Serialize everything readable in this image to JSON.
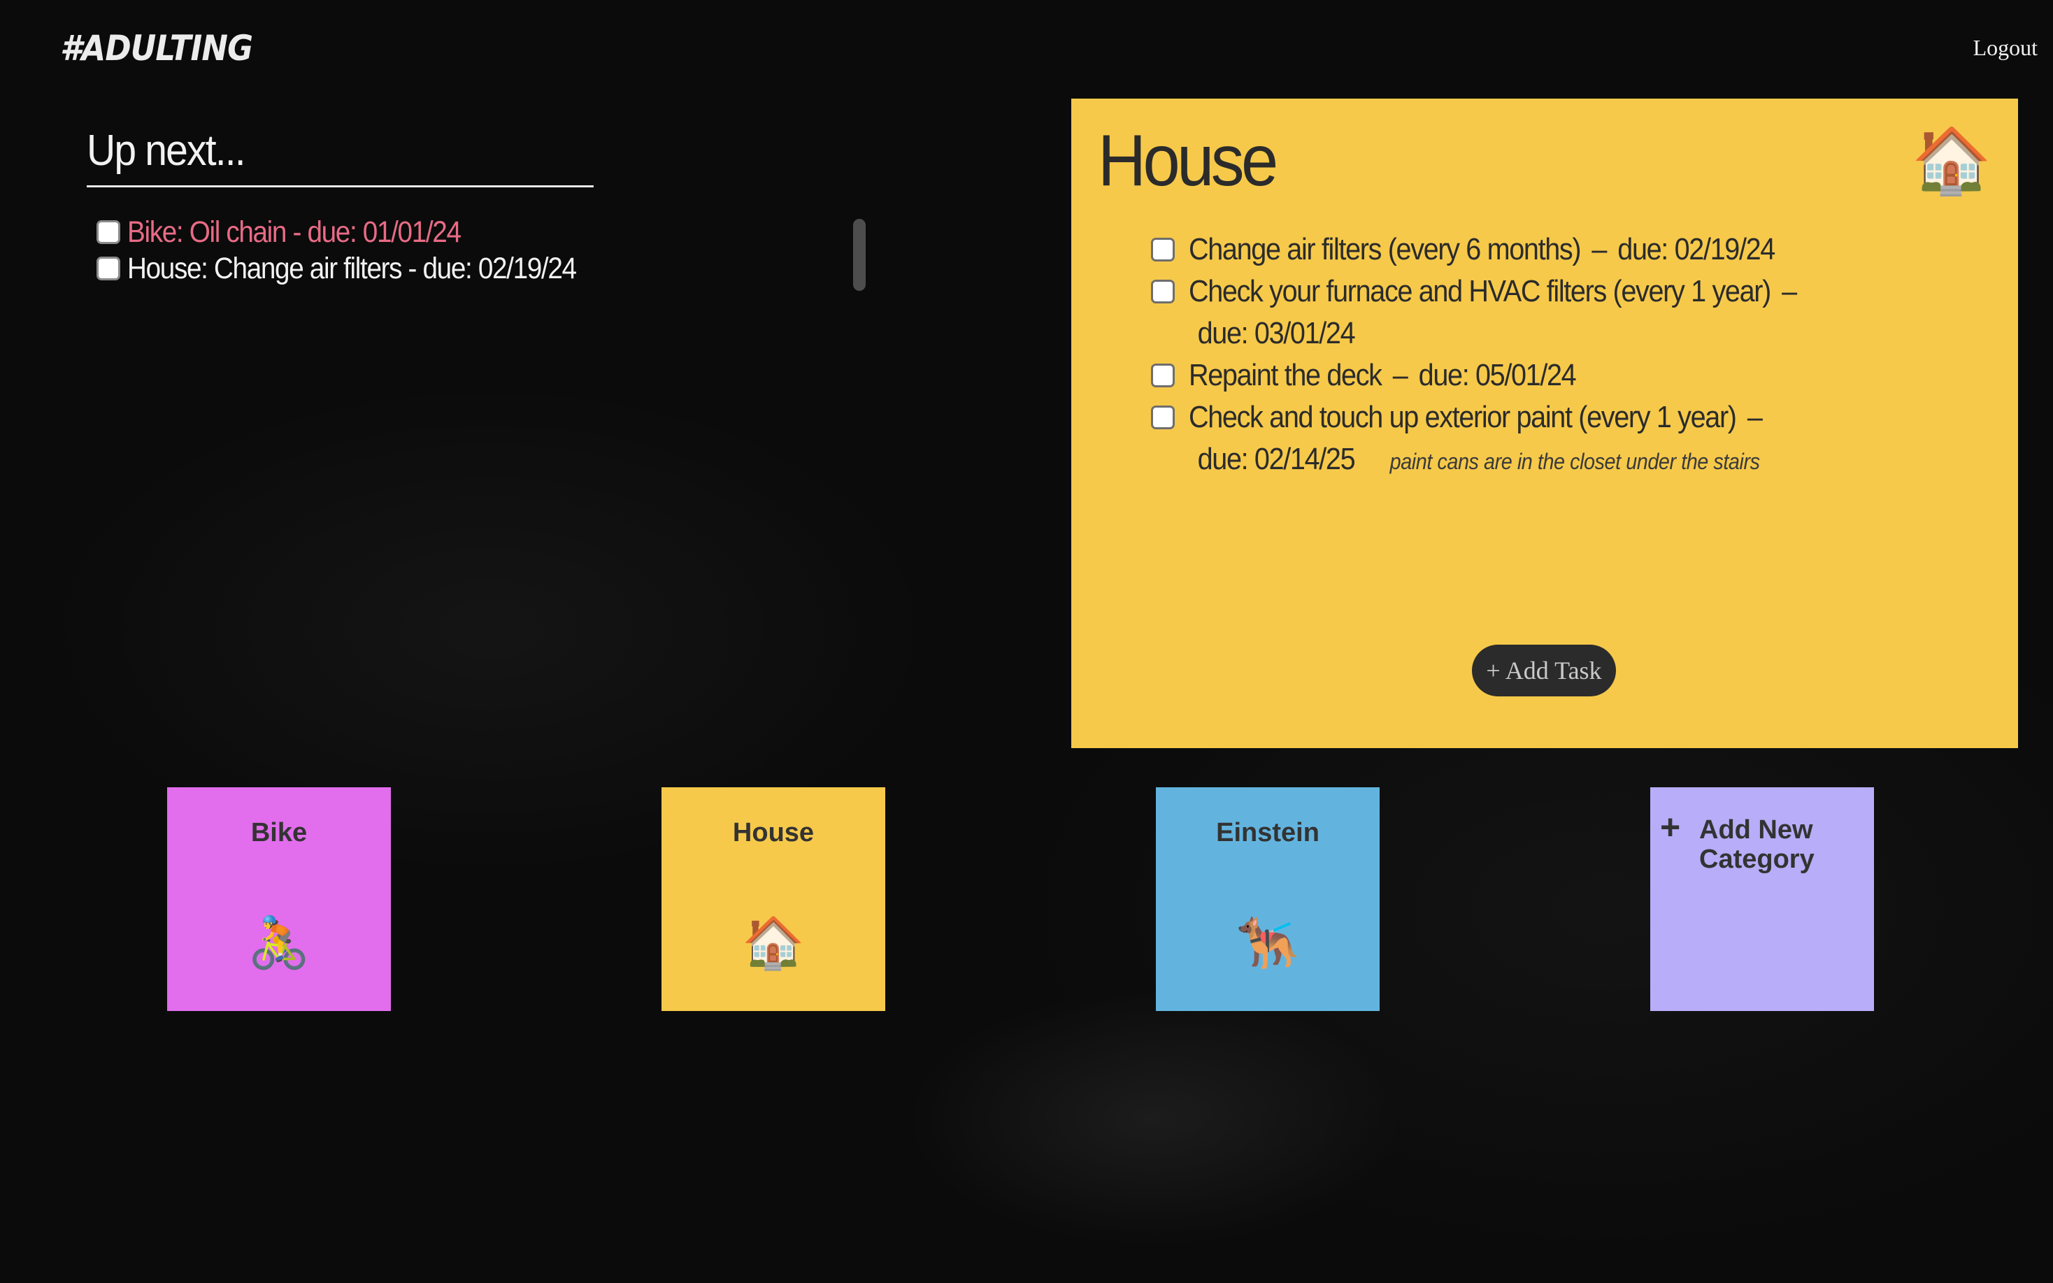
{
  "header": {
    "logo": "#ADULTING",
    "logout_label": "Logout"
  },
  "up_next": {
    "title": "Up next...",
    "items": [
      {
        "label": "Bike: Oil chain - due: 01/01/24",
        "status": "overdue",
        "checked": false
      },
      {
        "label": "House: Change air filters - due: 02/19/24",
        "status": "upcoming",
        "checked": false
      }
    ]
  },
  "panel": {
    "title": "House",
    "icon": "🏠",
    "tasks": [
      {
        "text": "Change air filters (every 6 months)",
        "sep": "–",
        "due": "due: 02/19/24",
        "wrap": false,
        "note": ""
      },
      {
        "text": "Check your furnace and HVAC filters (every 1 year)",
        "sep": "–",
        "due": "due: 03/01/24",
        "wrap": true,
        "note": ""
      },
      {
        "text": "Repaint the deck",
        "sep": "–",
        "due": "due: 05/01/24",
        "wrap": false,
        "note": ""
      },
      {
        "text": "Check and touch up exterior paint (every 1 year)",
        "sep": "–",
        "due": "due: 02/14/25",
        "wrap": true,
        "note": "paint cans are in the closet under the stairs"
      }
    ],
    "add_task_label": "+ Add Task",
    "color": "#f6c94a"
  },
  "categories": [
    {
      "name": "Bike",
      "icon": "🚴",
      "color": "#e26ded"
    },
    {
      "name": "House",
      "icon": "🏠",
      "color": "#f6c94a"
    },
    {
      "name": "Einstein",
      "icon": "🐕‍🦺",
      "color": "#62b4df"
    }
  ],
  "add_category": {
    "plus": "+",
    "label": "Add New Category",
    "color": "#b8adf8"
  },
  "colors": {
    "overdue": "#e86b86",
    "background": "#0b0b0b",
    "button_dark": "#2b2b2b"
  }
}
